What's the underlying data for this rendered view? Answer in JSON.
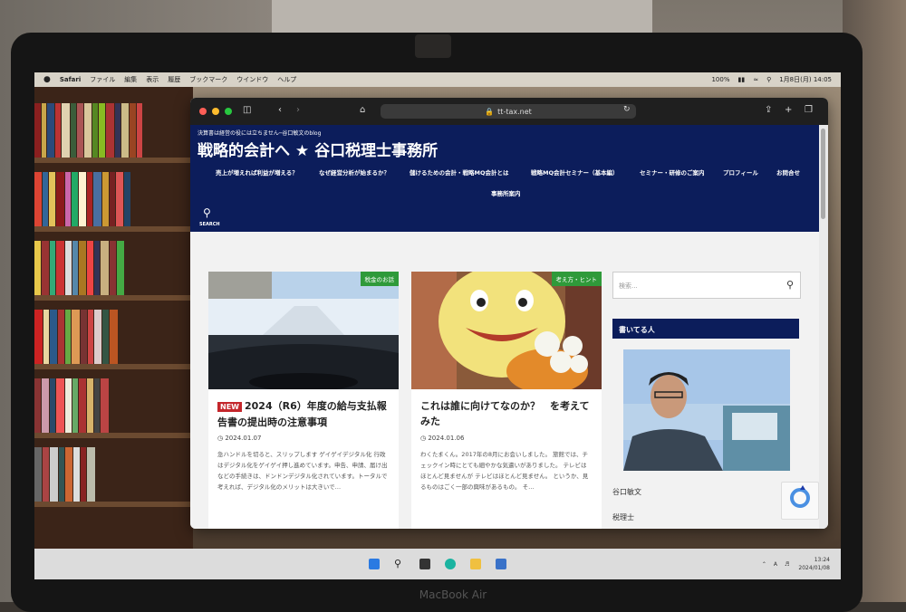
{
  "menubar": {
    "app": "Safari",
    "items": [
      "ファイル",
      "編集",
      "表示",
      "履歴",
      "ブックマーク",
      "ウインドウ",
      "ヘルプ"
    ],
    "battery": "100%",
    "datetime": "1月8日(月) 14:05"
  },
  "browser": {
    "url": "tt-tax.net"
  },
  "site": {
    "tagline": "決算書は経営の役には立ちません─谷口敏文のblog",
    "title": "戦略的会計へ ★ 谷口税理士事務所",
    "nav": [
      "売上が増えれば利益が増える？",
      "なぜ経営分析が始まるか？",
      "儲けるための会計・戦略MQ会計とは",
      "戦略MQ会計セミナー（基本編）",
      "セミナー・研修のご案内",
      "プロフィール",
      "お問合せ",
      "事務所案内"
    ],
    "search_label": "SEARCH"
  },
  "posts": [
    {
      "category": "税金のお話",
      "badge": "NEW",
      "title": "2024（R6）年度の給与支払報告書の提出時の注意事項",
      "date": "2024.01.07",
      "excerpt": "急ハンドルを切ると、スリップします ゲイゲイデジタル化 行政はデジタル化をゲイゲイ押し進めています。申告、申請、届け出などの手続きは、ドンドンデジタル化されています。トータルで考えれば、デジタル化のメリットは大きいで…"
    },
    {
      "category": "考え方・ヒント",
      "title": "これは誰に向けてなのか？　を考えてみた",
      "date": "2024.01.06",
      "excerpt": "わくたまくん。2017年の8月にお会いしました。 旅館では、チェックイン時にとても細やかな気遣いがありました。 テレビはほとんど見ませんが テレビはほとんど見ません。 というか、見るものはごく一部の興味があるもの。 そ…"
    }
  ],
  "sidebar": {
    "search_placeholder": "検索...",
    "author_heading": "書いてる人",
    "author_name": "谷口敏文",
    "author_role": "税理士"
  },
  "taskbar": {
    "time": "13:24",
    "date": "2024/01/08"
  },
  "laptop": {
    "model": "MacBook Air"
  },
  "colors": {
    "header_blue": "#0c1d5b",
    "category_green": "#2f9a3a",
    "new_red": "#c4262b"
  }
}
